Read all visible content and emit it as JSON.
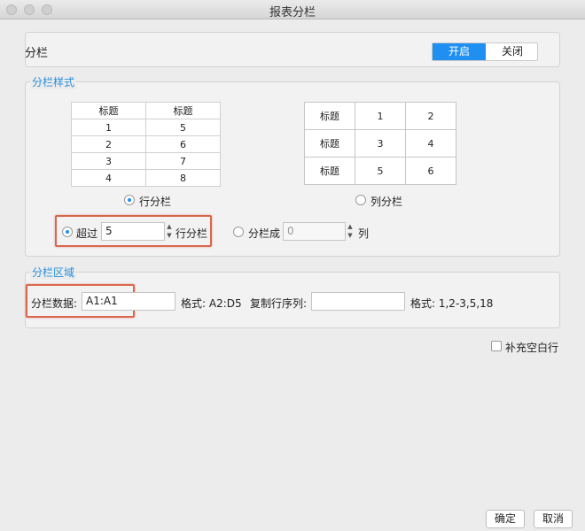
{
  "window": {
    "title": "报表分栏"
  },
  "toggle": {
    "label": "分栏",
    "on_label": "开启",
    "off_label": "关闭",
    "selected": "开启"
  },
  "style_section": {
    "title": "分栏样式",
    "row_table": {
      "headers": [
        "标题",
        "标题"
      ],
      "rows": [
        [
          "1",
          "5"
        ],
        [
          "2",
          "6"
        ],
        [
          "3",
          "7"
        ],
        [
          "4",
          "8"
        ]
      ]
    },
    "col_table": {
      "rows": [
        [
          "标题",
          "1",
          "2"
        ],
        [
          "标题",
          "3",
          "4"
        ],
        [
          "标题",
          "5",
          "6"
        ]
      ]
    },
    "row_radio_label": "行分栏",
    "col_radio_label": "列分栏",
    "exceed_label": "超过",
    "exceed_value": "5",
    "exceed_suffix": "行分栏",
    "split_label": "分栏成",
    "split_value": "0",
    "split_suffix": "列"
  },
  "area_section": {
    "title": "分栏区域",
    "data_label": "分栏数据:",
    "data_value": "A1:A1",
    "format_label": "格式: A2:D5",
    "copy_label": "复制行序列:",
    "copy_value": "",
    "copy_format_label": "格式: 1,2-3,5,18"
  },
  "fill_blank": {
    "label": "补充空白行",
    "checked": false
  },
  "buttons": {
    "ok": "确定",
    "cancel": "取消"
  },
  "colors": {
    "accent": "#1f8ff2",
    "section_title": "#2a8fd8",
    "highlight": "#d9674f"
  }
}
